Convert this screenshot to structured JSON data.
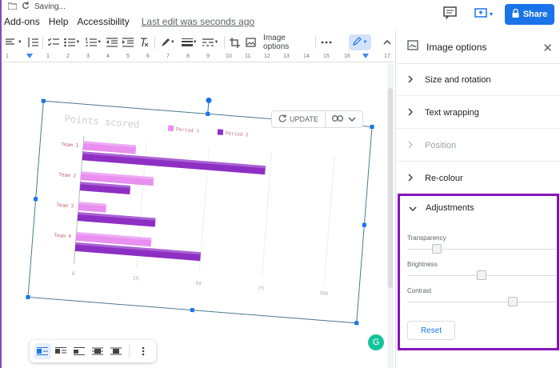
{
  "header": {
    "saving_text": "Saving...",
    "menu": [
      "Add-ons",
      "Help",
      "Accessibility"
    ],
    "last_edit": "Last edit was seconds ago",
    "share_label": "Share"
  },
  "toolbar": {
    "image_options_label": "Image options"
  },
  "ruler": {
    "ticks": [
      "1",
      "1",
      "2",
      "3",
      "4",
      "5",
      "6",
      "7",
      "8",
      "9",
      "10",
      "11",
      "12",
      "13",
      "14",
      "15",
      "16",
      "17"
    ]
  },
  "image_actions": {
    "update_label": "UPDATE"
  },
  "chart_data": {
    "type": "bar",
    "title": "Points scored",
    "orientation": "horizontal",
    "categories": [
      "Team 1",
      "Team 2",
      "Team 3",
      "Team 4"
    ],
    "series": [
      {
        "name": "Period 1",
        "color": "#e98ff0",
        "values": [
          21,
          29,
          11,
          30
        ]
      },
      {
        "name": "Period 2",
        "color": "#8e2fc4",
        "values": [
          73,
          20,
          31,
          50
        ]
      }
    ],
    "xlim": [
      0,
      100
    ],
    "xticks": [
      "0",
      "25",
      "50",
      "75",
      "100"
    ],
    "legend": "top"
  },
  "panel": {
    "title": "Image options",
    "sections": [
      {
        "label": "Size and rotation",
        "disabled": false
      },
      {
        "label": "Text wrapping",
        "disabled": false
      },
      {
        "label": "Position",
        "disabled": true
      },
      {
        "label": "Re-colour",
        "disabled": false
      }
    ],
    "adjustments": {
      "title": "Adjustments",
      "sliders": [
        {
          "label": "Transparency",
          "level": 0.2
        },
        {
          "label": "Brightness",
          "level": 0.5
        },
        {
          "label": "Contrast",
          "level": 0.71
        }
      ],
      "reset_label": "Reset"
    }
  },
  "colors": {
    "accent": "#1a73e8",
    "highlight_box": "#8b0fbe",
    "period1": "#e98ff0",
    "period2": "#8e2fc4"
  }
}
